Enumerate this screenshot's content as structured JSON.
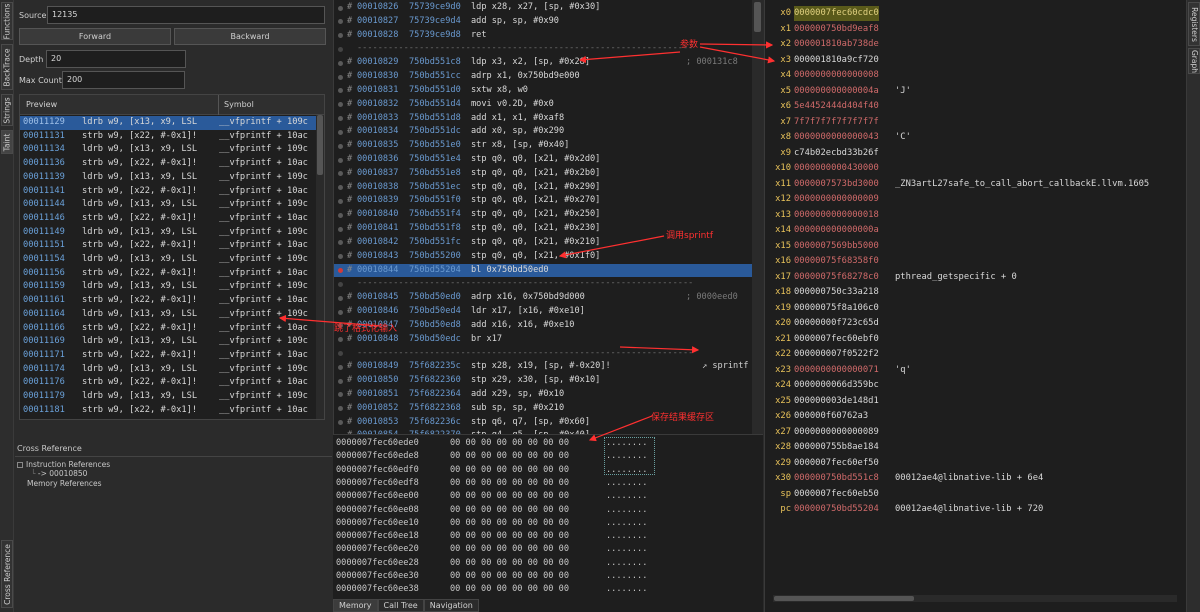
{
  "left_tabs": [
    "Functions",
    "BackTrace",
    "Strings",
    "Taint"
  ],
  "bottom_left_tab": "Cross Reference",
  "right_tabs": [
    "Registers",
    "Graph"
  ],
  "form": {
    "source_label": "Source",
    "source_value": "12135",
    "forward_label": "Forward",
    "backward_label": "Backward",
    "depth_label": "Depth",
    "depth_value": "20",
    "max_count_label": "Max Count",
    "max_count_value": "200"
  },
  "trace_list": {
    "columns": [
      "Preview",
      "Symbol"
    ],
    "rows": [
      {
        "n": "00011129",
        "i": "ldrb w9, [x13, x9, LSL",
        "s": "__vfprintf + 109c",
        "sel": true
      },
      {
        "n": "00011131",
        "i": "strb w9, [x22, #-0x1]!",
        "s": "__vfprintf + 10ac"
      },
      {
        "n": "00011134",
        "i": "ldrb w9, [x13, x9, LSL",
        "s": "__vfprintf + 109c"
      },
      {
        "n": "00011136",
        "i": "strb w9, [x22, #-0x1]!",
        "s": "__vfprintf + 10ac"
      },
      {
        "n": "00011139",
        "i": "ldrb w9, [x13, x9, LSL",
        "s": "__vfprintf + 109c"
      },
      {
        "n": "00011141",
        "i": "strb w9, [x22, #-0x1]!",
        "s": "__vfprintf + 10ac"
      },
      {
        "n": "00011144",
        "i": "ldrb w9, [x13, x9, LSL",
        "s": "__vfprintf + 109c"
      },
      {
        "n": "00011146",
        "i": "strb w9, [x22, #-0x1]!",
        "s": "__vfprintf + 10ac"
      },
      {
        "n": "00011149",
        "i": "ldrb w9, [x13, x9, LSL",
        "s": "__vfprintf + 109c"
      },
      {
        "n": "00011151",
        "i": "strb w9, [x22, #-0x1]!",
        "s": "__vfprintf + 10ac"
      },
      {
        "n": "00011154",
        "i": "ldrb w9, [x13, x9, LSL",
        "s": "__vfprintf + 109c"
      },
      {
        "n": "00011156",
        "i": "strb w9, [x22, #-0x1]!",
        "s": "__vfprintf + 10ac"
      },
      {
        "n": "00011159",
        "i": "ldrb w9, [x13, x9, LSL",
        "s": "__vfprintf + 109c"
      },
      {
        "n": "00011161",
        "i": "strb w9, [x22, #-0x1]!",
        "s": "__vfprintf + 10ac"
      },
      {
        "n": "00011164",
        "i": "ldrb w9, [x13, x9, LSL",
        "s": "__vfprintf + 109c"
      },
      {
        "n": "00011166",
        "i": "strb w9, [x22, #-0x1]!",
        "s": "__vfprintf + 10ac"
      },
      {
        "n": "00011169",
        "i": "ldrb w9, [x13, x9, LSL",
        "s": "__vfprintf + 109c"
      },
      {
        "n": "00011171",
        "i": "strb w9, [x22, #-0x1]!",
        "s": "__vfprintf + 10ac"
      },
      {
        "n": "00011174",
        "i": "ldrb w9, [x13, x9, LSL",
        "s": "__vfprintf + 109c"
      },
      {
        "n": "00011176",
        "i": "strb w9, [x22, #-0x1]!",
        "s": "__vfprintf + 10ac"
      },
      {
        "n": "00011179",
        "i": "ldrb w9, [x13, x9, LSL",
        "s": "__vfprintf + 109c"
      },
      {
        "n": "00011181",
        "i": "strb w9, [x22, #-0x1]!",
        "s": "__vfprintf + 10ac"
      }
    ]
  },
  "disasm": [
    {
      "t": "i",
      "n": "00010826",
      "a": "75739ce9d0",
      "x": "ldp x28, x27, [sp, #0x30]"
    },
    {
      "t": "i",
      "n": "00010827",
      "a": "75739ce9d4",
      "x": "add sp, sp, #0x90"
    },
    {
      "t": "i",
      "n": "00010828",
      "a": "75739ce9d8",
      "x": "ret"
    },
    {
      "t": "s",
      "txt": "-----------------------------------------------------------------"
    },
    {
      "t": "i",
      "n": "00010829",
      "a": "750bd551c8",
      "x": "ldp x3, x2, [sp, #0x28]",
      "c": "; 000131c8"
    },
    {
      "t": "i",
      "n": "00010830",
      "a": "750bd551cc",
      "x": "adrp x1, 0x750bd9e000"
    },
    {
      "t": "i",
      "n": "00010831",
      "a": "750bd551d0",
      "x": "sxtw x8, w0"
    },
    {
      "t": "i",
      "n": "00010832",
      "a": "750bd551d4",
      "x": "movi v0.2D, #0x0"
    },
    {
      "t": "i",
      "n": "00010833",
      "a": "750bd551d8",
      "x": "add x1, x1, #0xaf8"
    },
    {
      "t": "i",
      "n": "00010834",
      "a": "750bd551dc",
      "x": "add x0, sp, #0x290"
    },
    {
      "t": "i",
      "n": "00010835",
      "a": "750bd551e0",
      "x": "str x8, [sp, #0x40]"
    },
    {
      "t": "i",
      "n": "00010836",
      "a": "750bd551e4",
      "x": "stp q0, q0, [x21, #0x2d0]"
    },
    {
      "t": "i",
      "n": "00010837",
      "a": "750bd551e8",
      "x": "stp q0, q0, [x21, #0x2b0]"
    },
    {
      "t": "i",
      "n": "00010838",
      "a": "750bd551ec",
      "x": "stp q0, q0, [x21, #0x290]"
    },
    {
      "t": "i",
      "n": "00010839",
      "a": "750bd551f0",
      "x": "stp q0, q0, [x21, #0x270]"
    },
    {
      "t": "i",
      "n": "00010840",
      "a": "750bd551f4",
      "x": "stp q0, q0, [x21, #0x250]"
    },
    {
      "t": "i",
      "n": "00010841",
      "a": "750bd551f8",
      "x": "stp q0, q0, [x21, #0x230]"
    },
    {
      "t": "i",
      "n": "00010842",
      "a": "750bd551fc",
      "x": "stp q0, q0, [x21, #0x210]"
    },
    {
      "t": "i",
      "n": "00010843",
      "a": "750bd55200",
      "x": "stp q0, q0, [x21, #0x1f0]"
    },
    {
      "t": "i",
      "n": "00010844",
      "a": "750bd55204",
      "x": "bl 0x750bd50ed0",
      "hl": true,
      "red": true
    },
    {
      "t": "s",
      "txt": "-----------------------------------------------------------------"
    },
    {
      "t": "i",
      "n": "00010845",
      "a": "750bd50ed0",
      "x": "adrp x16, 0x750bd9d000",
      "c": "; 0000eed0"
    },
    {
      "t": "i",
      "n": "00010846",
      "a": "750bd50ed4",
      "x": "ldr x17, [x16, #0xe10]"
    },
    {
      "t": "i",
      "n": "00010847",
      "a": "750bd50ed8",
      "x": "add x16, x16, #0xe10"
    },
    {
      "t": "i",
      "n": "00010848",
      "a": "750bd50edc",
      "x": "br x17"
    },
    {
      "t": "s",
      "txt": "-----------------------------------------------------------------"
    },
    {
      "t": "i",
      "n": "00010849",
      "a": "75f682235c",
      "x": "stp x28, x19, [sp, #-0x20]!",
      "f": "sprintf"
    },
    {
      "t": "i",
      "n": "00010850",
      "a": "75f6822360",
      "x": "stp x29, x30, [sp, #0x10]"
    },
    {
      "t": "i",
      "n": "00010851",
      "a": "75f6822364",
      "x": "add x29, sp, #0x10"
    },
    {
      "t": "i",
      "n": "00010852",
      "a": "75f6822368",
      "x": "sub sp, sp, #0x210"
    },
    {
      "t": "i",
      "n": "00010853",
      "a": "75f682236c",
      "x": "stp q6, q7, [sp, #0x60]"
    },
    {
      "t": "i",
      "n": "00010854",
      "a": "75f6822370",
      "x": "stp q4, q5, [sp, #0x40]"
    },
    {
      "t": "i",
      "n": "00010855",
      "a": "75f6822374",
      "x": "stp q2, q3, [sp, #0x20]"
    }
  ],
  "xref": {
    "title": "Cross Reference",
    "instruction_refs": "Instruction References",
    "ref_item": "-> 00010850",
    "memory_refs": "Memory References"
  },
  "memory": {
    "rows": [
      {
        "a": "0000007fec60ede0",
        "h": "00 00 00 00 00 00 00 00",
        "s": "........"
      },
      {
        "a": "0000007fec60ede8",
        "h": "00 00 00 00 00 00 00 00",
        "s": "........"
      },
      {
        "a": "0000007fec60edf0",
        "h": "00 00 00 00 00 00 00 00",
        "s": "........"
      },
      {
        "a": "0000007fec60edf8",
        "h": "00 00 00 00 00 00 00 00",
        "s": "........"
      },
      {
        "a": "0000007fec60ee00",
        "h": "00 00 00 00 00 00 00 00",
        "s": "........"
      },
      {
        "a": "0000007fec60ee08",
        "h": "00 00 00 00 00 00 00 00",
        "s": "........"
      },
      {
        "a": "0000007fec60ee10",
        "h": "00 00 00 00 00 00 00 00",
        "s": "........"
      },
      {
        "a": "0000007fec60ee18",
        "h": "00 00 00 00 00 00 00 00",
        "s": "........"
      },
      {
        "a": "0000007fec60ee20",
        "h": "00 00 00 00 00 00 00 00",
        "s": "........"
      },
      {
        "a": "0000007fec60ee28",
        "h": "00 00 00 00 00 00 00 00",
        "s": "........"
      },
      {
        "a": "0000007fec60ee30",
        "h": "00 00 00 00 00 00 00 00",
        "s": "........"
      },
      {
        "a": "0000007fec60ee38",
        "h": "00 00 00 00 00 00 00 00",
        "s": "........"
      }
    ],
    "tabs": [
      "Memory",
      "Call Tree",
      "Navigation"
    ]
  },
  "registers": [
    {
      "n": "x0",
      "v": "0000007fec60cdc0",
      "hl": true
    },
    {
      "n": "x1",
      "v": "000000750bd9eaf8"
    },
    {
      "n": "x2",
      "v": "000001810ab738de"
    },
    {
      "n": "x3",
      "v": "000001810a9cf720",
      "plain": true
    },
    {
      "n": "x4",
      "v": "0000000000000008"
    },
    {
      "n": "x5",
      "v": "000000000000004a",
      "c": "'J'"
    },
    {
      "n": "x6",
      "v": "5e4452444d404f40"
    },
    {
      "n": "x7",
      "v": "7f7f7f7f7f7f7f7f"
    },
    {
      "n": "x8",
      "v": "0000000000000043",
      "c": "'C'"
    },
    {
      "n": "x9",
      "v": "c74b02ecbd33b26f",
      "plain": true
    },
    {
      "n": "x10",
      "v": "0000000000430000"
    },
    {
      "n": "x11",
      "v": "0000007573bd3000",
      "c": "_ZN3artL27safe_to_call_abort_callbackE.llvm.1605"
    },
    {
      "n": "x12",
      "v": "0000000000000009"
    },
    {
      "n": "x13",
      "v": "0000000000000018"
    },
    {
      "n": "x14",
      "v": "000000000000000a"
    },
    {
      "n": "x15",
      "v": "0000007569bb5000"
    },
    {
      "n": "x16",
      "v": "00000075f68358f0"
    },
    {
      "n": "x17",
      "v": "00000075f68278c0",
      "c": "pthread_getspecific + 0"
    },
    {
      "n": "x18",
      "v": "000000750c33a218",
      "plain": true
    },
    {
      "n": "x19",
      "v": "00000075f8a106c0",
      "plain": true
    },
    {
      "n": "x20",
      "v": "00000000f723c65d",
      "plain": true
    },
    {
      "n": "x21",
      "v": "0000007fec60ebf0",
      "plain": true
    },
    {
      "n": "x22",
      "v": "000000007f0522f2",
      "plain": true
    },
    {
      "n": "x23",
      "v": "0000000000000071",
      "c": "'q'"
    },
    {
      "n": "x24",
      "v": "0000000066d359bc",
      "plain": true
    },
    {
      "n": "x25",
      "v": "000000003de148d1",
      "plain": true
    },
    {
      "n": "x26",
      "v": "000000f60762a3",
      "plain": true
    },
    {
      "n": "x27",
      "v": "0000000000000089",
      "plain": true
    },
    {
      "n": "x28",
      "v": "000000755b8ae184",
      "plain": true
    },
    {
      "n": "x29",
      "v": "0000007fec60ef50",
      "plain": true
    },
    {
      "n": "x30",
      "v": "000000750bd551c8",
      "c": "00012ae4@libnative-lib + 6e4"
    },
    {
      "n": "sp",
      "v": "0000007fec60eb50",
      "plain": true
    },
    {
      "n": "pc",
      "v": "000000750bd55204",
      "c": "00012ae4@libnative-lib + 720"
    }
  ],
  "annotations": {
    "params": "参数",
    "call_sprintf": "调用sprintf",
    "jump_formatter": "跳了格式化输入",
    "save_buffer": "保存结果缓存区"
  },
  "colors": {
    "accent": "#2a5a9a",
    "annotation": "#ff3030",
    "register_name": "#e8c25a",
    "register_value": "#d06a6a"
  }
}
